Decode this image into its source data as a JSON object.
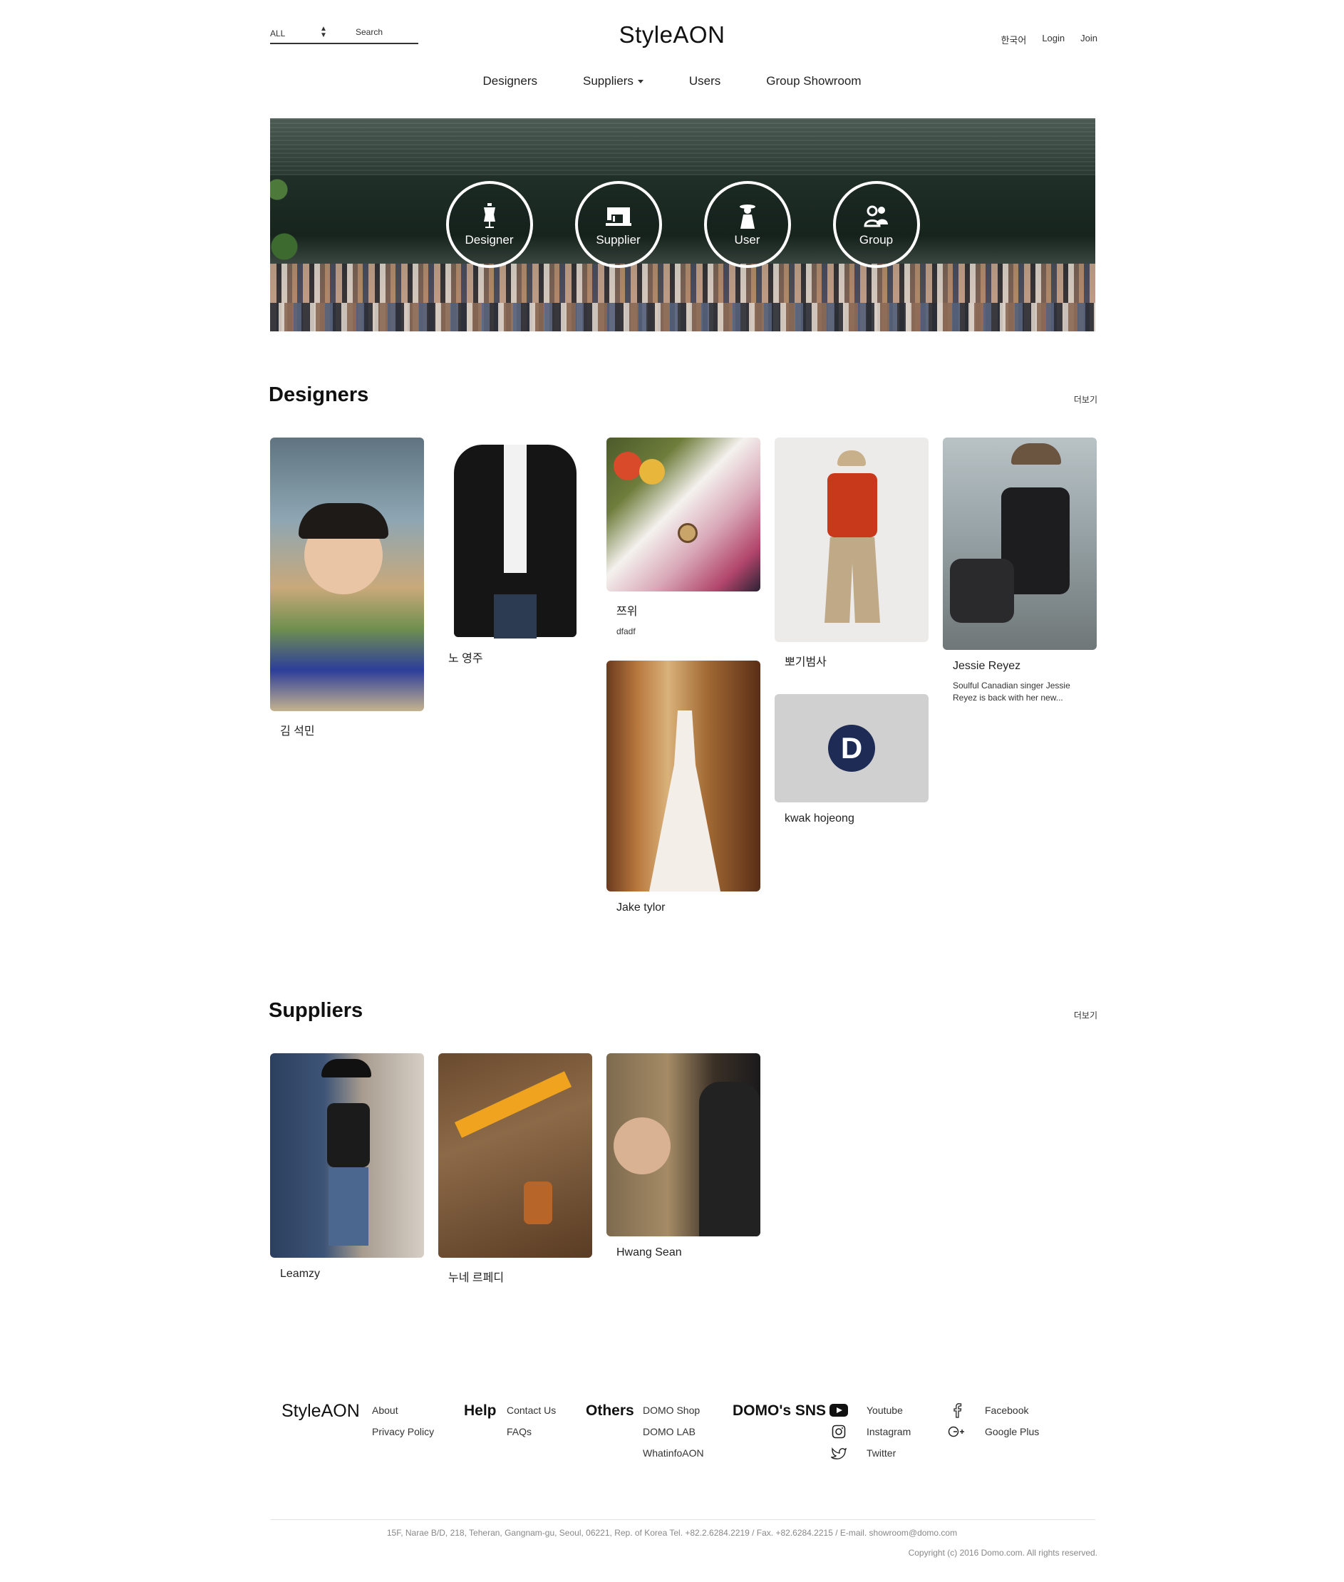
{
  "header": {
    "search_select": "ALL",
    "search_placeholder": "Search",
    "logo": "StyleAON",
    "language": "한국어",
    "login": "Login",
    "join": "Join"
  },
  "nav": {
    "items": [
      {
        "label": "Designers"
      },
      {
        "label": "Suppliers"
      },
      {
        "label": "Users"
      },
      {
        "label": "Group Showroom"
      }
    ]
  },
  "hero": {
    "buttons": [
      {
        "label": "Designer",
        "icon": "dress-form-icon"
      },
      {
        "label": "Supplier",
        "icon": "sewing-machine-icon"
      },
      {
        "label": "User",
        "icon": "woman-hat-icon"
      },
      {
        "label": "Group",
        "icon": "group-users-icon"
      }
    ]
  },
  "designers": {
    "title": "Designers",
    "more": "더보기",
    "cards": [
      {
        "name": "김 석민",
        "desc": ""
      },
      {
        "name": "노 영주",
        "desc": ""
      },
      {
        "name": "쯔위",
        "desc": "dfadf"
      },
      {
        "name": "Jake tylor",
        "desc": ""
      },
      {
        "name": "뽀기범사",
        "desc": ""
      },
      {
        "name": "kwak hojeong",
        "desc": ""
      },
      {
        "name": "Jessie Reyez",
        "desc": "Soulful Canadian singer Jessie Reyez is back with her new..."
      }
    ]
  },
  "suppliers": {
    "title": "Suppliers",
    "more": "더보기",
    "cards": [
      {
        "name": "Leamzy"
      },
      {
        "name": "누네 르페디"
      },
      {
        "name": "Hwang Sean"
      }
    ]
  },
  "footer": {
    "logo": "StyleAON",
    "brand_links": [
      "About",
      "Privacy Policy"
    ],
    "help_title": "Help",
    "help_links": [
      "Contact Us",
      "FAQs"
    ],
    "others_title": "Others",
    "others_links": [
      "DOMO Shop",
      "DOMO LAB",
      "WhatinfoAON"
    ],
    "sns_title": "DOMO's SNS",
    "sns": [
      {
        "label": "Youtube",
        "icon": "youtube-icon"
      },
      {
        "label": "Instagram",
        "icon": "instagram-icon"
      },
      {
        "label": "Twitter",
        "icon": "twitter-icon"
      },
      {
        "label": "Facebook",
        "icon": "facebook-icon"
      },
      {
        "label": "Google Plus",
        "icon": "google-plus-icon"
      }
    ],
    "address": "15F, Narae B/D, 218, Teheran, Gangnam-gu, Seoul, 06221, Rep. of Korea Tel. +82.2.6284.2219 / Fax. +82.6284.2215 / E-mail. showroom@domo.com",
    "copyright": "Copyright (c) 2016 Domo.com. All rights reserved."
  }
}
